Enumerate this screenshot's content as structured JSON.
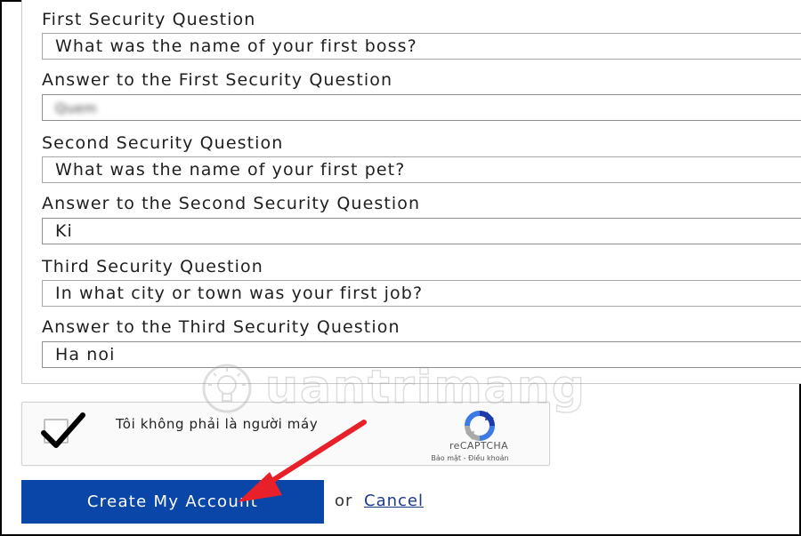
{
  "form": {
    "q1_label": "First Security Question",
    "q1_value": "What was the name of your first boss?",
    "a1_label": "Answer to the First Security Question",
    "a1_value": "Quem",
    "q2_label": "Second Security Question",
    "q2_value": "What was the name of your first pet?",
    "a2_label": "Answer to the Second Security Question",
    "a2_value": "Ki",
    "q3_label": "Third Security Question",
    "q3_value": "In what city or town was your first job?",
    "a3_label": "Answer to the Third Security Question",
    "a3_value": "Ha noi"
  },
  "recaptcha": {
    "checked": true,
    "label": "Tôi không phải là người máy",
    "brand": "reCAPTCHA",
    "terms": "Bảo mật - Điều khoản"
  },
  "actions": {
    "create_label": "Create My Account",
    "or_text": "or",
    "cancel_label": "Cancel"
  },
  "watermark": {
    "text": "uantrimang"
  },
  "colors": {
    "button_bg": "#0a46a8",
    "annotation_arrow": "#e8202a",
    "recaptcha_blue": "#3c7ae6",
    "recaptcha_gray": "#a9a9a9"
  }
}
